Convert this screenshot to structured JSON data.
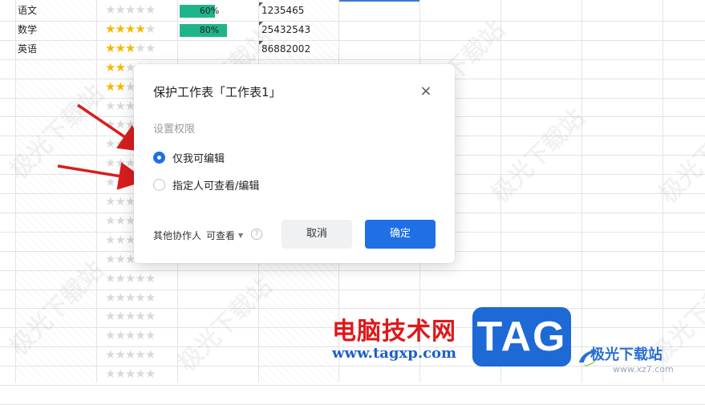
{
  "rows": [
    {
      "subject": "语文",
      "stars_on": 0,
      "stars_total": 5,
      "progress_label": "60%",
      "progress": 0.6,
      "number": "1235465"
    },
    {
      "subject": "数学",
      "stars_on": 4,
      "stars_total": 5,
      "progress_label": "80%",
      "progress": 0.8,
      "number": "25432543"
    },
    {
      "subject": "英语",
      "stars_on": 3,
      "stars_total": 5,
      "progress_label": "",
      "progress": 0,
      "number": "86882002"
    },
    {
      "subject": "",
      "stars_on": 2,
      "stars_total": 5
    },
    {
      "subject": "",
      "stars_on": 2,
      "stars_total": 5
    },
    {
      "subject": "",
      "stars_on": 0,
      "stars_total": 5
    },
    {
      "subject": "",
      "stars_on": 0,
      "stars_total": 5
    },
    {
      "subject": "",
      "stars_on": 0,
      "stars_total": 5
    },
    {
      "subject": "",
      "stars_on": 0,
      "stars_total": 5
    },
    {
      "subject": "",
      "stars_on": 0,
      "stars_total": 5
    },
    {
      "subject": "",
      "stars_on": 0,
      "stars_total": 5
    },
    {
      "subject": "",
      "stars_on": 0,
      "stars_total": 5
    },
    {
      "subject": "",
      "stars_on": 0,
      "stars_total": 5
    },
    {
      "subject": "",
      "stars_on": 0,
      "stars_total": 5
    },
    {
      "subject": "",
      "stars_on": 0,
      "stars_total": 5
    },
    {
      "subject": "",
      "stars_on": 0,
      "stars_total": 5
    },
    {
      "subject": "",
      "stars_on": 0,
      "stars_total": 5
    },
    {
      "subject": "",
      "stars_on": 0,
      "stars_total": 5
    },
    {
      "subject": "",
      "stars_on": 0,
      "stars_total": 5
    },
    {
      "subject": "",
      "stars_on": 0,
      "stars_total": 5
    }
  ],
  "dialog": {
    "title": "保护工作表「工作表1」",
    "section_label": "设置权限",
    "options": [
      {
        "label": "仅我可编辑",
        "checked": true
      },
      {
        "label": "指定人可查看/编辑",
        "checked": false
      }
    ],
    "others_label": "其他协作人",
    "others_value": "可查看",
    "help_glyph": "?",
    "cancel_label": "取消",
    "ok_label": "确定",
    "close_glyph": "×"
  },
  "watermark_text": "极光下载站",
  "branding": {
    "cn_title": "电脑技术网",
    "url": "www.tagxp.com",
    "tag": "TAG",
    "site_name": "极光下载站",
    "site_url": "www.xz7.com"
  },
  "colors": {
    "accent": "#1f6fe5",
    "star_on": "#f5b800",
    "bar_fill": "#1fb58a",
    "arrow": "#d81e1e"
  },
  "icons": {
    "close": "close-icon",
    "help": "help-icon",
    "dropdown": "caret-down-icon",
    "star": "star-icon"
  }
}
